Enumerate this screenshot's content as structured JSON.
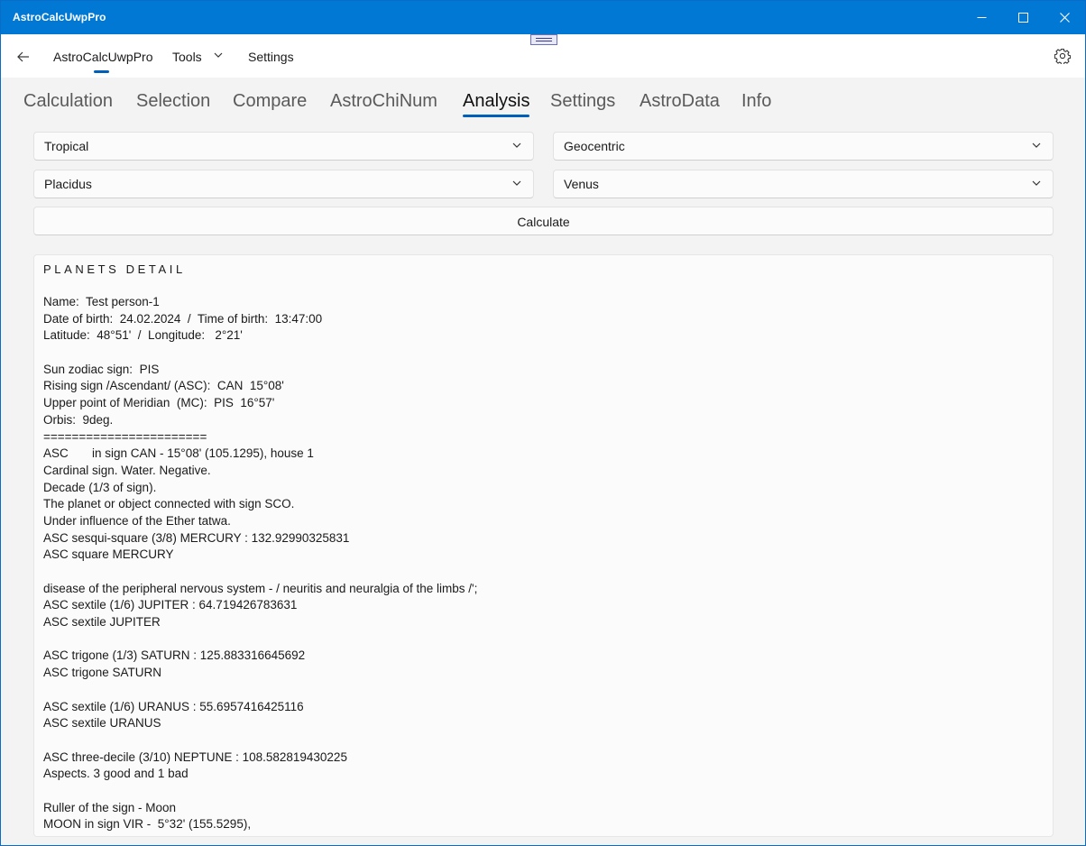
{
  "window": {
    "title": "AstroCalcUwpPro"
  },
  "nav": {
    "home_label": "AstroCalcUwpPro",
    "tools_label": "Tools",
    "settings_label": "Settings"
  },
  "tabs": [
    {
      "label": "Calculation"
    },
    {
      "label": "Selection"
    },
    {
      "label": "Compare"
    },
    {
      "label": "AstroChiNum"
    },
    {
      "label": "Analysis",
      "active": true
    },
    {
      "label": "Settings"
    },
    {
      "label": "AstroData"
    },
    {
      "label": "Info"
    }
  ],
  "controls": {
    "zodiac": "Tropical",
    "coordinates": "Geocentric",
    "house_system": "Placidus",
    "planet": "Venus",
    "calculate_label": "Calculate"
  },
  "output": {
    "heading": "PLANETS DETAIL",
    "lines": [
      "Name:  Test person-1",
      "Date of birth:  24.02.2024  /  Time of birth:  13:47:00",
      "Latitude:  48°51'  /  Longitude:   2°21'",
      "",
      "Sun zodiac sign:  PIS",
      "Rising sign /Ascendant/ (ASC):  CAN  15°08'",
      "Upper point of Meridian  (MC):  PIS  16°57'",
      "Orbis:  9deg.",
      "=======================",
      "ASC       in sign CAN - 15°08' (105.1295), house 1",
      "Cardinal sign. Water. Negative.",
      "Decade (1/3 of sign).",
      "The planet or object connected with sign SCO.",
      "Under influence of the Ether tatwa.",
      "ASC sesqui-square (3/8) MERCURY : 132.92990325831",
      "ASC square MERCURY",
      "",
      "disease of the peripheral nervous system - / neuritis and neuralgia of the limbs /';",
      "ASC sextile (1/6) JUPITER : 64.719426783631",
      "ASC sextile JUPITER",
      "",
      "ASC trigone (1/3) SATURN : 125.883316645692",
      "ASC trigone SATURN",
      "",
      "ASC sextile (1/6) URANUS : 55.6957416425116",
      "ASC sextile URANUS",
      "",
      "ASC three-decile (3/10) NEPTUNE : 108.582819430225",
      "Aspects. 3 good and 1 bad",
      "",
      "Ruller of the sign - Moon",
      "MOON in sign VIR -  5°32' (155.5295),"
    ]
  },
  "colors": {
    "titlebar": "#0078d4",
    "accent": "#005fb8",
    "background": "#f3f3f3"
  }
}
